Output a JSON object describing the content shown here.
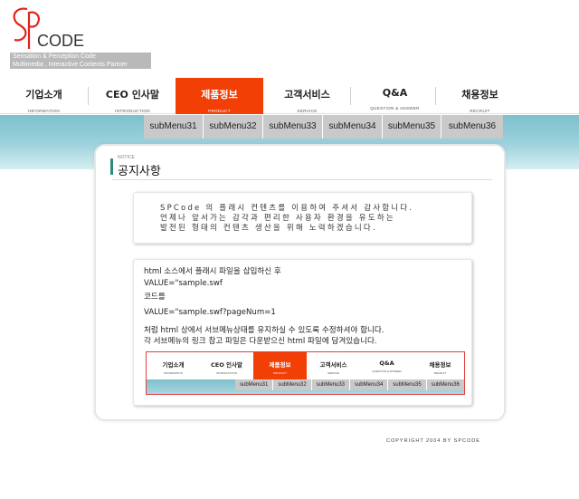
{
  "brand": {
    "logo_text": "CODE",
    "tagline_line1": "Sensation & Perception Code",
    "tagline_line2": "Multimedia , Interactive Contents Partner",
    "accent": "#f13f05",
    "teal": "#7ec0cd"
  },
  "nav": {
    "items": [
      {
        "label": "기업소개",
        "sub": "INFORMATION"
      },
      {
        "label": "CEO 인사말",
        "sub": "INTRODUCTION"
      },
      {
        "label": "제품정보",
        "sub": "PRODUCT",
        "active": true
      },
      {
        "label": "고객서비스",
        "sub": "SERVICE"
      },
      {
        "label": "Q&A",
        "sub": "QUESTION & ANSWER"
      },
      {
        "label": "채용정보",
        "sub": "RECRUIT"
      }
    ]
  },
  "submenu": {
    "items": [
      "subMenu31",
      "subMenu32",
      "subMenu33",
      "subMenu34",
      "subMenu35",
      "subMenu36"
    ]
  },
  "notice": {
    "eyebrow": "NOTICE",
    "title": "공지사항"
  },
  "intro": {
    "line1": "SPCode 의 플래시 컨텐츠를 이용하여 주셔서 감사합니다.",
    "line2": "언제나 앞서가는 감각과 편리한 사용자 환경을  유도하는",
    "line3": "발전된 형태의 컨텐츠 생산을 위해 노력하겠습니다."
  },
  "info": {
    "line1": "html 소스에서 플래시 파일을 삽입하신 후",
    "line2": "VALUE=\"sample.swf",
    "line3": "코드를",
    "line4": "VALUE=\"sample.swf?pageNum=1",
    "line5": "처럼 html 상에서 서브메뉴상태를 유지하실 수  있도록 수정하셔야 합니다.",
    "line6": "각 서브메뉴의 링크 참고 파일은 다운받으신 html 파일에 담겨있습니다."
  },
  "footer": {
    "copyright": "COPYRIGHT 2004 BY SPCODE"
  }
}
